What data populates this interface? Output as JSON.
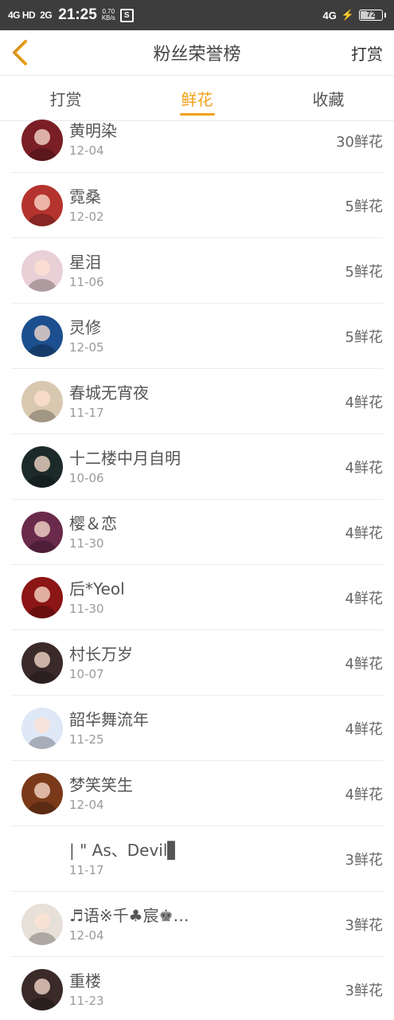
{
  "status_bar": {
    "signal1": "4G HD",
    "signal2": "2G",
    "time": "21:25",
    "speed_value": "0.70",
    "speed_unit": "KB/s",
    "s_icon": "S",
    "network": "4G",
    "battery": "72",
    "battery_level": 0.72
  },
  "header": {
    "back_icon": "chevron-left-icon",
    "title": "粉丝荣誉榜",
    "action": "打赏",
    "accent_color": "#f0a017"
  },
  "tabs": [
    {
      "label": "打赏",
      "active": false
    },
    {
      "label": "鲜花",
      "active": true
    },
    {
      "label": "收藏",
      "active": false
    }
  ],
  "fans": [
    {
      "name": "黄明染",
      "date": "12-04",
      "count": "30鲜花",
      "avatar_color": "#7a1f25"
    },
    {
      "name": "霓桑",
      "date": "12-02",
      "count": "5鲜花",
      "avatar_color": "#b5332e"
    },
    {
      "name": "星泪",
      "date": "11-06",
      "count": "5鲜花",
      "avatar_color": "#e9cfd6"
    },
    {
      "name": "灵修",
      "date": "12-05",
      "count": "5鲜花",
      "avatar_color": "#1c4f8f"
    },
    {
      "name": "春城无宵夜",
      "date": "11-17",
      "count": "4鲜花",
      "avatar_color": "#d9c8b0"
    },
    {
      "name": "十二楼中月自明",
      "date": "10-06",
      "count": "4鲜花",
      "avatar_color": "#1d2a2a"
    },
    {
      "name": "樱＆恋",
      "date": "11-30",
      "count": "4鲜花",
      "avatar_color": "#6a2a4c"
    },
    {
      "name": "后*Yeol",
      "date": "11-30",
      "count": "4鲜花",
      "avatar_color": "#8c1515"
    },
    {
      "name": "村长万岁",
      "date": "10-07",
      "count": "4鲜花",
      "avatar_color": "#3b2a2a"
    },
    {
      "name": "韶华舞流年",
      "date": "11-25",
      "count": "4鲜花",
      "avatar_color": "#dfe8f7"
    },
    {
      "name": "梦笑笑生",
      "date": "12-04",
      "count": "4鲜花",
      "avatar_color": "#7a3a1a"
    },
    {
      "name": "| \" As、Devil▋",
      "date": "11-17",
      "count": "3鲜花",
      "avatar_color": "#ffffff"
    },
    {
      "name": "♬语※千♣宸♚…",
      "date": "12-04",
      "count": "3鲜花",
      "avatar_color": "#e7e0d8"
    },
    {
      "name": "重楼",
      "date": "11-23",
      "count": "3鲜花",
      "avatar_color": "#3a2a28"
    }
  ]
}
